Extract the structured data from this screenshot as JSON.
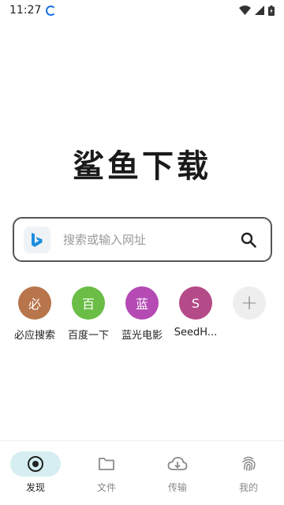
{
  "status_bar": {
    "time": "11:27",
    "icons": [
      "sync-icon",
      "wifi-icon",
      "signal-icon",
      "battery-icon"
    ]
  },
  "logo": {
    "text": "鲨鱼下载"
  },
  "search": {
    "engine_icon": "bing-icon",
    "placeholder": "搜索或输入网址",
    "search_icon": "search-icon"
  },
  "shortcuts": [
    {
      "glyph": "必",
      "label": "必应搜索",
      "color": "#b8754b"
    },
    {
      "glyph": "百",
      "label": "百度一下",
      "color": "#6abd45"
    },
    {
      "glyph": "蓝",
      "label": "蓝光电影",
      "color": "#b54ab4"
    },
    {
      "glyph": "S",
      "label": "SeedH...",
      "color": "#b54a88"
    },
    {
      "glyph": "+",
      "label": "",
      "color": "#eeeeee"
    }
  ],
  "bottom_nav": [
    {
      "label": "发现",
      "icon": "discover-icon",
      "active": true
    },
    {
      "label": "文件",
      "icon": "folder-icon",
      "active": false
    },
    {
      "label": "传输",
      "icon": "cloud-download-icon",
      "active": false
    },
    {
      "label": "我的",
      "icon": "fingerprint-icon",
      "active": false
    }
  ]
}
